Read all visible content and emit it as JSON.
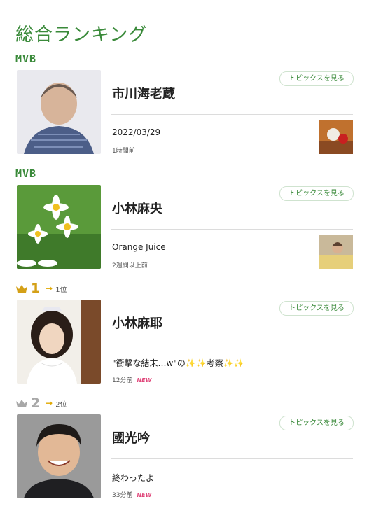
{
  "page_title": "総合ランキング",
  "topics_button_label": "トピックスを見る",
  "entries": [
    {
      "badge": "MVB",
      "name": "市川海老蔵",
      "post_title": "2022/03/29",
      "post_time": "1時間前",
      "has_post_thumb": true
    },
    {
      "badge": "MVB",
      "name": "小林麻央",
      "post_title": "Orange Juice",
      "post_time": "2週間以上前",
      "has_post_thumb": true
    },
    {
      "rank": "1",
      "arrow": "➞",
      "prev_rank": "1位",
      "name": "小林麻耶",
      "post_title": "\"衝撃な結末…w\"の✨✨考察✨✨",
      "post_time": "12分前",
      "new_label": "NEW",
      "has_post_thumb": false
    },
    {
      "rank": "2",
      "arrow": "➞",
      "prev_rank": "2位",
      "name": "國光吟",
      "post_title": "終わったよ",
      "post_time": "33分前",
      "new_label": "NEW",
      "has_post_thumb": false
    }
  ],
  "colors": {
    "accent_green": "#3a8a3a",
    "new_pink": "#e0467a",
    "arrow_gold": "#e0a800",
    "crown_gold": "#d4a017",
    "crown_silver": "#a8a8a8"
  }
}
